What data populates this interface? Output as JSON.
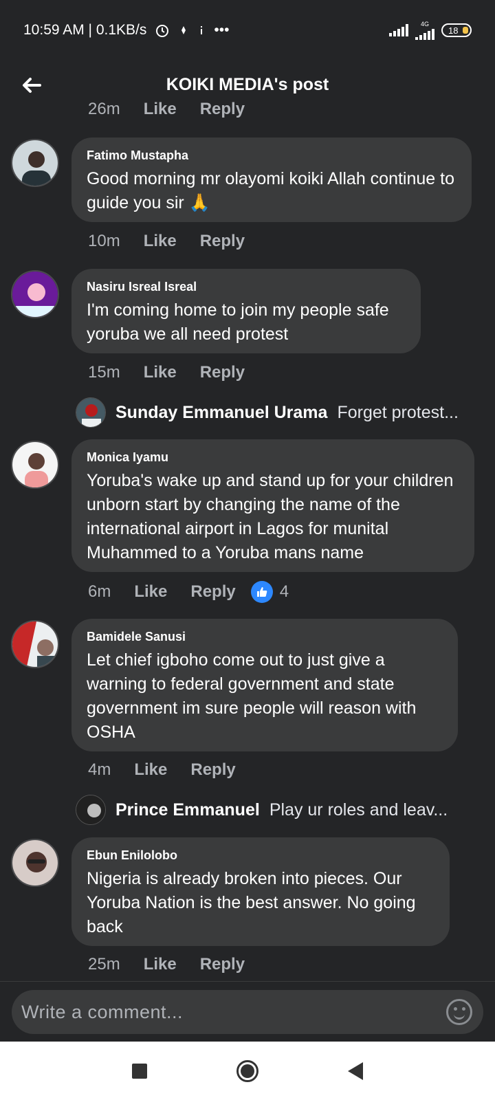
{
  "status_bar": {
    "time_speed": "10:59 AM | 0.1KB/s",
    "more": "•••",
    "network": "4G",
    "battery": "18"
  },
  "header": {
    "title": "KOIKI MEDIA's post"
  },
  "comments": [
    {
      "time": "26m",
      "like": "Like",
      "reply": "Reply"
    },
    {
      "author": "Fatimo Mustapha",
      "text": "Good morning mr olayomi koiki Allah continue to guide you sir 🙏",
      "time": "10m",
      "like": "Like",
      "reply": "Reply"
    },
    {
      "author": "Nasiru Isreal Isreal",
      "text": "I'm coming home to join my people safe yoruba we all need protest",
      "time": "15m",
      "like": "Like",
      "reply": "Reply",
      "reply_preview": {
        "author": "Sunday Emmanuel Urama",
        "text": "Forget protest..."
      }
    },
    {
      "author": "Monica Iyamu",
      "text": "Yoruba's wake up and stand up for your children unborn  start by changing the name of the international airport in Lagos for munital Muhammed to a Yoruba mans name",
      "time": "6m",
      "like": "Like",
      "reply": "Reply",
      "reactions": "4"
    },
    {
      "author": "Bamidele Sanusi",
      "text": "Let chief igboho come out to just give a warning to federal government and state government im sure people will reason with OSHA",
      "time": "4m",
      "like": "Like",
      "reply": "Reply",
      "reply_preview": {
        "author": "Prince Emmanuel",
        "text": "Play ur roles and leav..."
      }
    },
    {
      "author": "Ebun Enilolobo",
      "text": "Nigeria is already broken into pieces.   Our Yoruba Nation is the best answer. No going back",
      "time": "25m",
      "like": "Like",
      "reply": "Reply"
    }
  ],
  "composer": {
    "placeholder": "Write a comment..."
  },
  "colors": {
    "background": "#242527",
    "bubble": "#3a3b3c",
    "secondary_text": "#b0b3b8",
    "like_blue": "#2d88ff"
  }
}
